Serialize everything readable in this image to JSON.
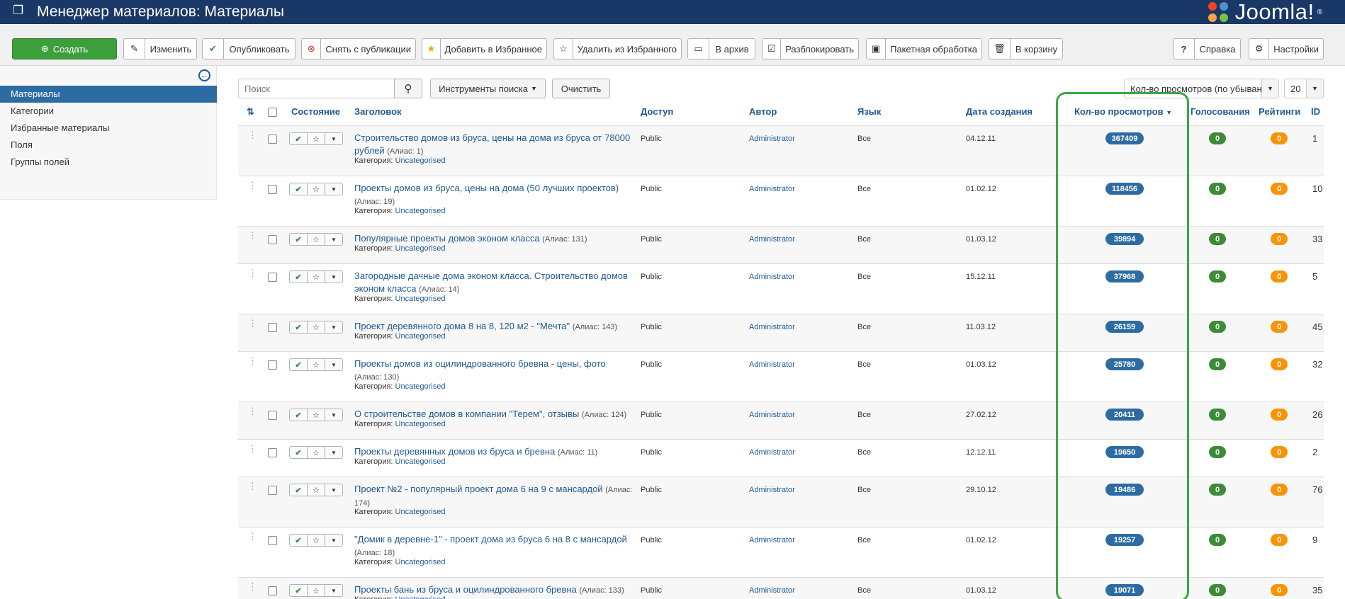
{
  "header": {
    "title": "Менеджер материалов: Материалы",
    "logo_text": "Joomla!",
    "logo_mark": "®"
  },
  "toolbar": {
    "create": "Создать",
    "edit": "Изменить",
    "publish": "Опубликовать",
    "unpublish": "Снять с публикации",
    "feature": "Добавить в Избранное",
    "unfeature": "Удалить из Избранного",
    "archive": "В архив",
    "checkin": "Разблокировать",
    "batch": "Пакетная обработка",
    "trash": "В корзину",
    "help": "Справка",
    "options": "Настройки"
  },
  "sidebar": {
    "items": [
      "Материалы",
      "Категории",
      "Избранные материалы",
      "Поля",
      "Группы полей"
    ],
    "active_index": 0
  },
  "filters": {
    "search_placeholder": "Поиск",
    "search_tools": "Инструменты поиска",
    "clear": "Очистить",
    "ordering": "Кол-во просмотров (по убыванию)",
    "limit": "20"
  },
  "columns": {
    "status": "Состояние",
    "title": "Заголовок",
    "access": "Доступ",
    "author": "Автор",
    "language": "Язык",
    "date_created": "Дата создания",
    "hits": "Кол-во просмотров",
    "votes": "Голосования",
    "ratings": "Рейтинги",
    "id": "ID"
  },
  "category_label": "Категория:",
  "alias_label": "Алиас:",
  "rows": [
    {
      "title": "Строительство домов из бруса, цены на дома из бруса от 78000 рублей",
      "alias": "(Алиас: 1)",
      "category": "Uncategorised",
      "access": "Public",
      "author": "Administrator",
      "language": "Все",
      "date": "04.12.11",
      "hits": "367409",
      "votes": "0",
      "rating": "0",
      "id": "1"
    },
    {
      "title": "Проекты домов из бруса, цены на дома (50 лучших проектов)",
      "alias": "(Алиас: 19)",
      "category": "Uncategorised",
      "access": "Public",
      "author": "Administrator",
      "language": "Все",
      "date": "01.02.12",
      "hits": "118456",
      "votes": "0",
      "rating": "0",
      "id": "10"
    },
    {
      "title": "Популярные проекты домов эконом класса",
      "alias": "(Алиас: 131)",
      "category": "Uncategorised",
      "access": "Public",
      "author": "Administrator",
      "language": "Все",
      "date": "01.03.12",
      "hits": "39894",
      "votes": "0",
      "rating": "0",
      "id": "33"
    },
    {
      "title": "Загородные дачные дома эконом класса. Строительство домов эконом класса",
      "alias": "(Алиас: 14)",
      "category": "Uncategorised",
      "access": "Public",
      "author": "Administrator",
      "language": "Все",
      "date": "15.12.11",
      "hits": "37968",
      "votes": "0",
      "rating": "0",
      "id": "5"
    },
    {
      "title": "Проект деревянного дома 8 на 8, 120 м2 - \"Мечта\"",
      "alias": "(Алиас: 143)",
      "category": "Uncategorised",
      "access": "Public",
      "author": "Administrator",
      "language": "Все",
      "date": "11.03.12",
      "hits": "26159",
      "votes": "0",
      "rating": "0",
      "id": "45"
    },
    {
      "title": "Проекты домов из оцилиндрованного бревна - цены, фото",
      "alias": "(Алиас: 130)",
      "category": "Uncategorised",
      "access": "Public",
      "author": "Administrator",
      "language": "Все",
      "date": "01.03.12",
      "hits": "25780",
      "votes": "0",
      "rating": "0",
      "id": "32"
    },
    {
      "title": "О строительстве домов в компании \"Терем\", отзывы",
      "alias": "(Алиас: 124)",
      "category": "Uncategorised",
      "access": "Public",
      "author": "Administrator",
      "language": "Все",
      "date": "27.02.12",
      "hits": "20411",
      "votes": "0",
      "rating": "0",
      "id": "26"
    },
    {
      "title": "Проекты деревянных домов из бруса и бревна",
      "alias": "(Алиас: 11)",
      "category": "Uncategorised",
      "access": "Public",
      "author": "Administrator",
      "language": "Все",
      "date": "12.12.11",
      "hits": "19650",
      "votes": "0",
      "rating": "0",
      "id": "2"
    },
    {
      "title": "Проект №2 - популярный проект дома 6 на 9 с мансардой",
      "alias": "(Алиас: 174)",
      "category": "Uncategorised",
      "access": "Public",
      "author": "Administrator",
      "language": "Все",
      "date": "29.10.12",
      "hits": "19486",
      "votes": "0",
      "rating": "0",
      "id": "76"
    },
    {
      "title": "\"Домик в деревне-1\" - проект дома из бруса 6 на 8 с мансардой",
      "alias": "(Алиас: 18)",
      "category": "Uncategorised",
      "access": "Public",
      "author": "Administrator",
      "language": "Все",
      "date": "01.02.12",
      "hits": "19257",
      "votes": "0",
      "rating": "0",
      "id": "9"
    },
    {
      "title": "Проекты бань из бруса и оцилиндрованного бревна",
      "alias": "(Алиас: 133)",
      "category": "Uncategorised",
      "access": "Public",
      "author": "Administrator",
      "language": "Все",
      "date": "01.03.12",
      "hits": "19071",
      "votes": "0",
      "rating": "0",
      "id": "35"
    }
  ],
  "colors": {
    "header": "#1a3867",
    "accent": "#2d6ca2",
    "green": "#3d8b37",
    "orange": "#f89406",
    "highlight": "#3aa845"
  }
}
